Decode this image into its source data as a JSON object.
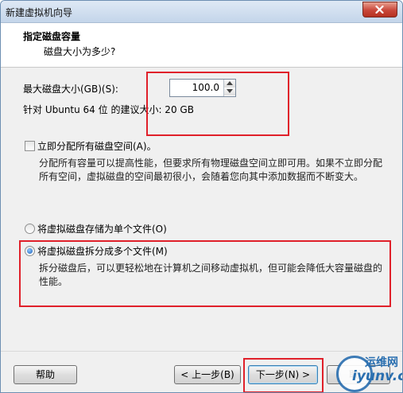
{
  "window": {
    "title": "新建虚拟机向导"
  },
  "header": {
    "title": "指定磁盘容量",
    "subtitle": "磁盘大小为多少?"
  },
  "disk": {
    "max_size_label": "最大磁盘大小(GB)(S):",
    "max_size_value": "100.0",
    "recommend_text": "针对 Ubuntu 64 位 的建议大小: 20 GB"
  },
  "allocate": {
    "label": "立即分配所有磁盘空间(A)。",
    "checked": false,
    "desc_line1": "分配所有容量可以提高性能，但要求所有物理磁盘空间立即可用。如果不立即分配",
    "desc_line2": "所有空间，虚拟磁盘的空间最初很小，会随着您向其中添加数据而不断变大。"
  },
  "store_options": {
    "single_label": "将虚拟磁盘存储为单个文件(O)",
    "multi_label": "将虚拟磁盘拆分成多个文件(M)",
    "selected": "multi",
    "multi_desc_line1": "拆分磁盘后，可以更轻松地在计算机之间移动虚拟机，但可能会降低大容量磁盘的",
    "multi_desc_line2": "性能。"
  },
  "footer": {
    "help": "帮助",
    "back": "< 上一步(B)",
    "next": "下一步(N) >",
    "cancel": "取消"
  },
  "watermark": {
    "top": "运维网",
    "bottom": "iyunv.com"
  },
  "colors": {
    "highlight": "#e0202a",
    "accent": "#2a6fb0"
  }
}
